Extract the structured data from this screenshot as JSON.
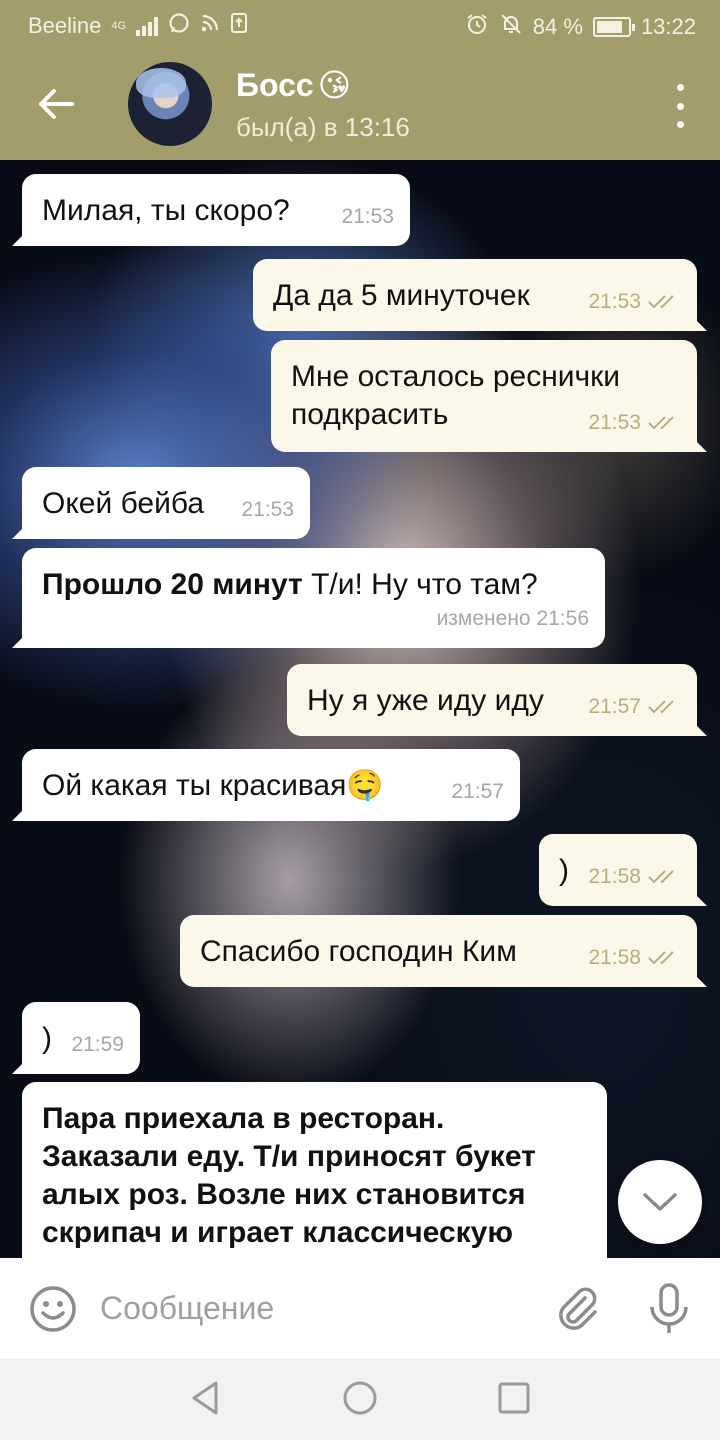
{
  "status_bar": {
    "carrier": "Beeline",
    "network": "4G",
    "battery": "84 %",
    "battery_level": 0.84,
    "time": "13:22"
  },
  "header": {
    "name": "Босс",
    "name_emoji": "😘",
    "status": "был(а) в 13:16"
  },
  "messages": [
    {
      "dir": "in",
      "text": "Милая, ты скоро?",
      "time": "21:53"
    },
    {
      "dir": "out",
      "text": "Да да 5 минуточек",
      "time": "21:53",
      "read": true
    },
    {
      "dir": "out",
      "text": "Мне осталось реснички подкрасить",
      "time": "21:53",
      "read": true
    },
    {
      "dir": "in",
      "text": "Окей бейба",
      "time": "21:53"
    },
    {
      "dir": "in",
      "bold_text": "Прошло 20 минут",
      "text": " Т/и! Ну что там?",
      "time": "изменено 21:56"
    },
    {
      "dir": "out",
      "text": "Ну я уже иду иду",
      "time": "21:57",
      "read": true
    },
    {
      "dir": "in",
      "text": "Ой какая ты красивая🤤",
      "time": "21:57"
    },
    {
      "dir": "out",
      "text": ")",
      "time": "21:58",
      "read": true
    },
    {
      "dir": "out",
      "text": "Спасибо господин Ким",
      "time": "21:58",
      "read": true
    },
    {
      "dir": "in",
      "text": ")",
      "time": "21:59"
    },
    {
      "dir": "in",
      "bold_text": "Пара приехала в ресторан. Заказали еду. Т/и приносят букет алых роз. Возле них становится скрипач и играет классическую"
    }
  ],
  "input": {
    "placeholder": "Сообщение"
  },
  "colors": {
    "header_bg": "#a39d6b",
    "incoming_bubble": "#ffffff",
    "outgoing_bubble": "#fbf8ea",
    "read_check": "#b7ae7f"
  },
  "icons": {
    "back": "arrow-left-icon",
    "menu": "more-vert-icon",
    "fab": "chevron-down-icon",
    "emoji": "smiley-icon",
    "attach": "paperclip-icon",
    "mic": "mic-icon"
  }
}
